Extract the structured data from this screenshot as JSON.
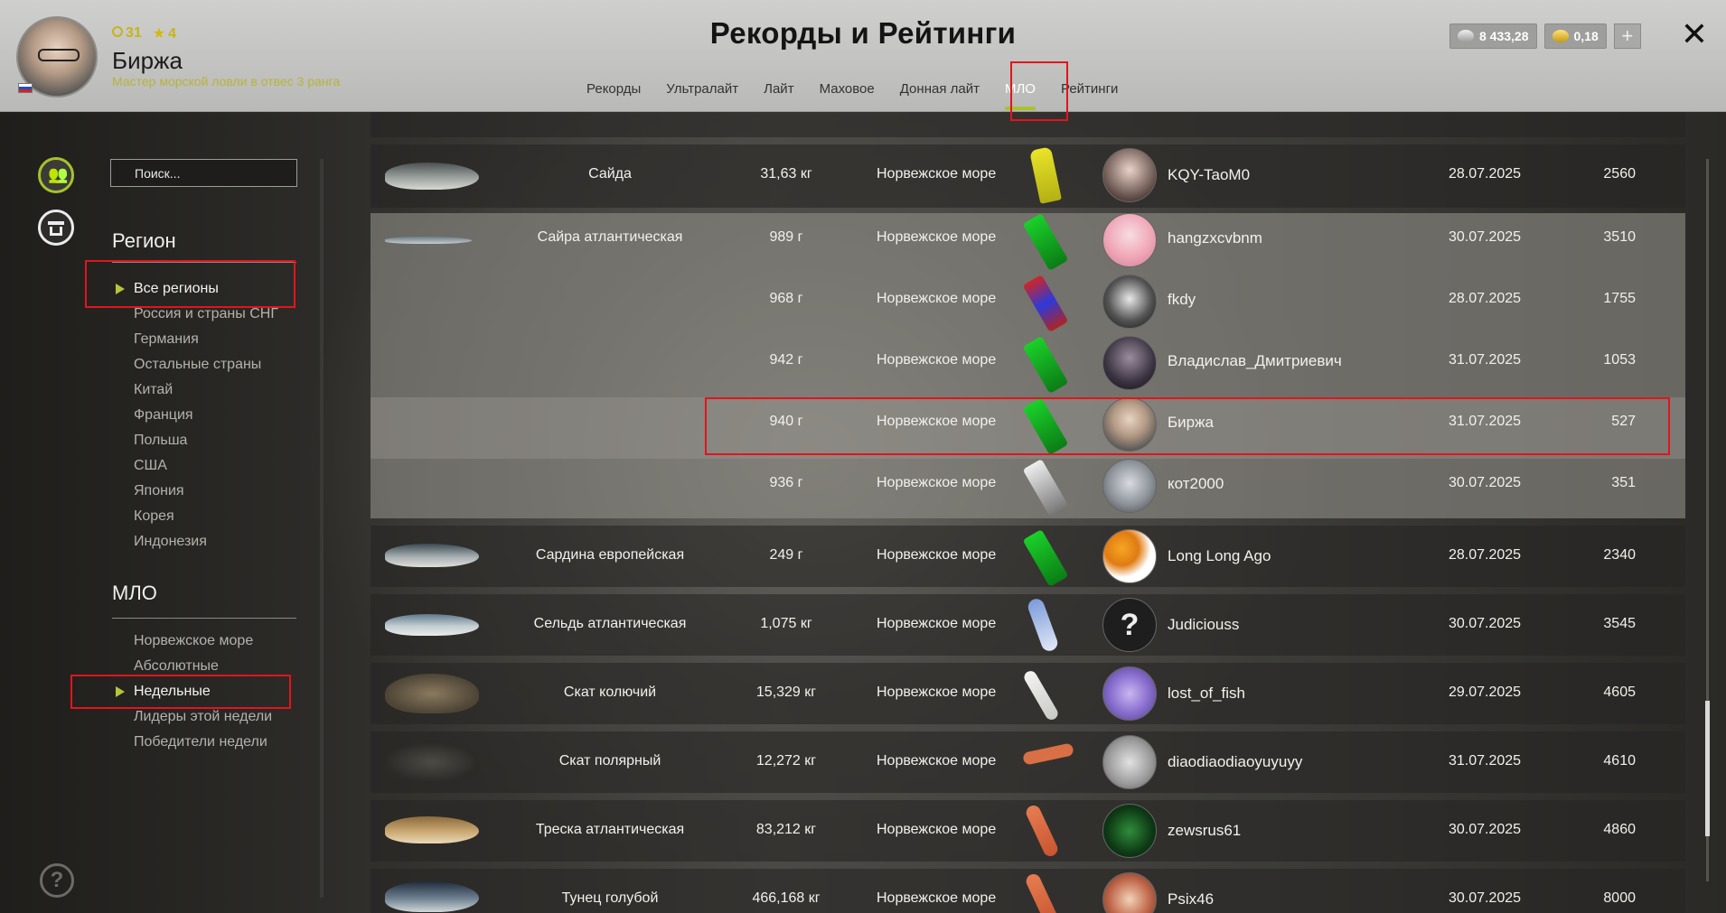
{
  "header": {
    "title": "Рекорды и Рейтинги",
    "user": {
      "name": "Биржа",
      "rank_title": "Мастер морской ловли в отвес 3 ранга",
      "level": "31",
      "stars": "4"
    },
    "currency": {
      "silver": "8 433,28",
      "gold": "0,18",
      "add_label": "+"
    },
    "close_label": "✕",
    "tabs": [
      {
        "label": "Рекорды",
        "active": false
      },
      {
        "label": "Ультралайт",
        "active": false
      },
      {
        "label": "Лайт",
        "active": false
      },
      {
        "label": "Маховое",
        "active": false
      },
      {
        "label": "Донная лайт",
        "active": false
      },
      {
        "label": "МЛО",
        "active": true
      },
      {
        "label": "Рейтинги",
        "active": false
      }
    ]
  },
  "sidebar": {
    "search_placeholder": "Поиск...",
    "region_title": "Регион",
    "regions": [
      {
        "label": "Все регионы",
        "selected": true
      },
      {
        "label": "Россия и страны СНГ",
        "selected": false
      },
      {
        "label": "Германия",
        "selected": false
      },
      {
        "label": "Остальные страны",
        "selected": false
      },
      {
        "label": "Китай",
        "selected": false
      },
      {
        "label": "Франция",
        "selected": false
      },
      {
        "label": "Польша",
        "selected": false
      },
      {
        "label": "США",
        "selected": false
      },
      {
        "label": "Япония",
        "selected": false
      },
      {
        "label": "Корея",
        "selected": false
      },
      {
        "label": "Индонезия",
        "selected": false
      }
    ],
    "mlo_title": "МЛО",
    "mlo_items": [
      {
        "label": "Норвежское море",
        "selected": false
      },
      {
        "label": "Абсолютные",
        "selected": false
      },
      {
        "label": "Недельные",
        "selected": true
      },
      {
        "label": "Лидеры этой недели",
        "selected": false
      },
      {
        "label": "Победители недели",
        "selected": false
      }
    ],
    "help_label": "?"
  },
  "records": [
    {
      "fish": "Сайда",
      "weight": "31,63 кг",
      "location": "Норвежское море",
      "player": "KQY-TaoM0",
      "date": "28.07.2025",
      "points": "2560"
    },
    {
      "fish": "Сайра атлантическая",
      "weight": "989 г",
      "location": "Норвежское море",
      "player": "hangzxcvbnm",
      "date": "30.07.2025",
      "points": "3510"
    },
    {
      "fish": "",
      "weight": "968 г",
      "location": "Норвежское море",
      "player": "fkdy",
      "date": "28.07.2025",
      "points": "1755"
    },
    {
      "fish": "",
      "weight": "942 г",
      "location": "Норвежское море",
      "player": "Владислав_Дмитриевич",
      "date": "31.07.2025",
      "points": "1053"
    },
    {
      "fish": "",
      "weight": "940 г",
      "location": "Норвежское море",
      "player": "Биржа",
      "date": "31.07.2025",
      "points": "527"
    },
    {
      "fish": "",
      "weight": "936 г",
      "location": "Норвежское море",
      "player": "кот2000",
      "date": "30.07.2025",
      "points": "351"
    },
    {
      "fish": "Сардина европейская",
      "weight": "249 г",
      "location": "Норвежское море",
      "player": "Long Long Ago",
      "date": "28.07.2025",
      "points": "2340"
    },
    {
      "fish": "Сельдь атлантическая",
      "weight": "1,075 кг",
      "location": "Норвежское море",
      "player": "Judiciouss",
      "date": "30.07.2025",
      "points": "3545"
    },
    {
      "fish": "Скат колючий",
      "weight": "15,329 кг",
      "location": "Норвежское море",
      "player": "lost_of_fish",
      "date": "29.07.2025",
      "points": "4605"
    },
    {
      "fish": "Скат полярный",
      "weight": "12,272 кг",
      "location": "Норвежское море",
      "player": "diaodiaodiaoyuyuyy",
      "date": "31.07.2025",
      "points": "4610"
    },
    {
      "fish": "Треска атлантическая",
      "weight": "83,212 кг",
      "location": "Норвежское море",
      "player": "zewsrus61",
      "date": "30.07.2025",
      "points": "4860"
    },
    {
      "fish": "Тунец голубой",
      "weight": "466,168 кг",
      "location": "Норвежское море",
      "player": "Psix46",
      "date": "30.07.2025",
      "points": "8000"
    }
  ],
  "colors": {
    "accent": "#a9c22c",
    "highlight": "#e3141c"
  }
}
